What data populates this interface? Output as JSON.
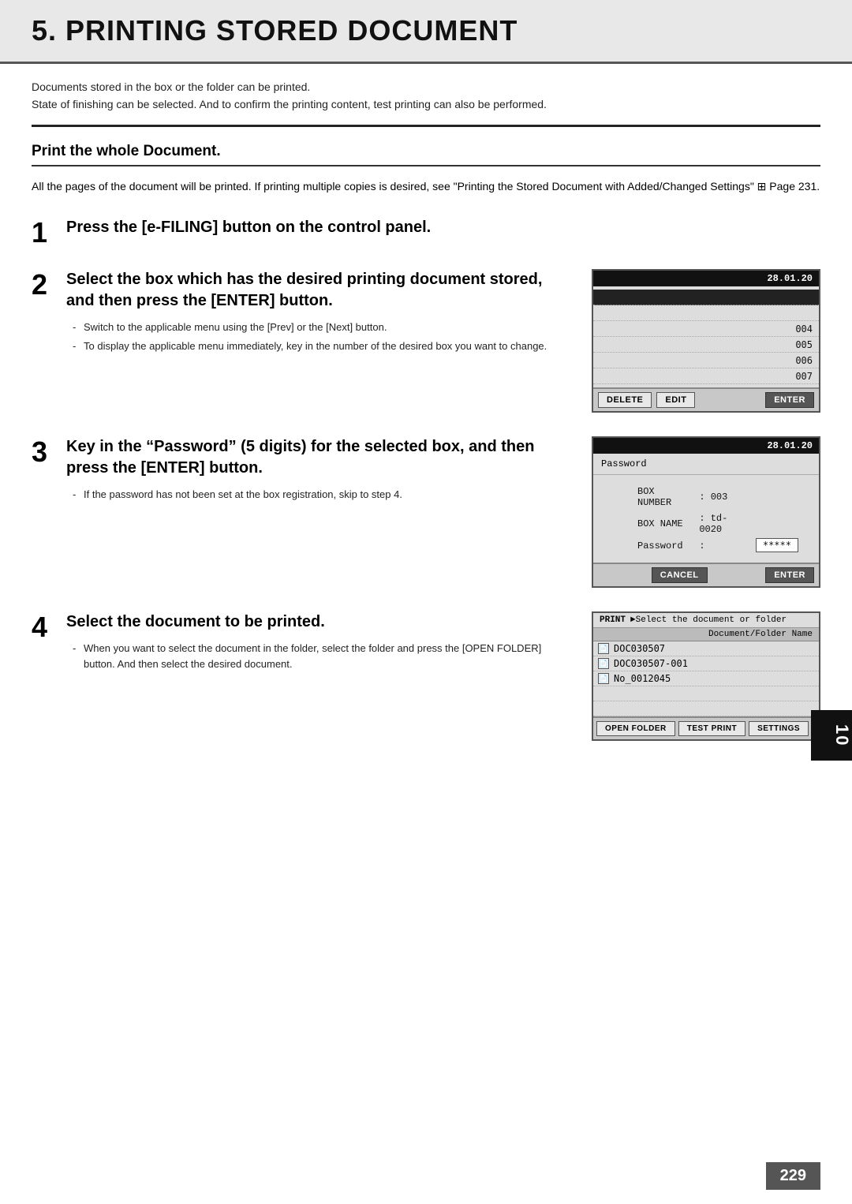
{
  "page": {
    "title": "5. PRINTING STORED DOCUMENT",
    "chapter_number": "10",
    "page_number": "229"
  },
  "intro": {
    "line1": "Documents stored in the box or the folder can be printed.",
    "line2": "State of finishing can be selected. And to confirm the printing content, test printing can also be performed."
  },
  "section1": {
    "heading": "Print the whole Document.",
    "body": "All the pages of the document will be printed. If printing multiple copies is desired, see \"Printing the Stored Document with Added/Changed Settings\" ⊞ Page 231."
  },
  "step1": {
    "number": "1",
    "title": "Press the [e-FILING] button on the control panel."
  },
  "step2": {
    "number": "2",
    "title": "Select the box which has the desired printing document stored, and then press the [ENTER] button.",
    "bullets": [
      "Switch to the applicable menu using the [Prev] or the [Next] button.",
      "To display the applicable menu immediately, key in the number of the desired box you want to change."
    ],
    "screen": {
      "topbar": "28.01.20",
      "rows": [
        {
          "label": "",
          "num": "",
          "selected": true
        },
        {
          "label": "",
          "num": "",
          "selected": false
        },
        {
          "label": "",
          "num": "004",
          "selected": false
        },
        {
          "label": "",
          "num": "005",
          "selected": false
        },
        {
          "label": "",
          "num": "006",
          "selected": false
        },
        {
          "label": "",
          "num": "007",
          "selected": false
        }
      ],
      "buttons": {
        "delete": "DELETE",
        "edit": "EDIT",
        "enter": "ENTER"
      }
    }
  },
  "step3": {
    "number": "3",
    "title": "Key in the “Password” (5 digits) for the selected box, and then press the [ENTER] button.",
    "bullets": [
      "If the password has not been set at the box registration, skip to step 4."
    ],
    "screen": {
      "topbar": "28.01.20",
      "password_label": "Password",
      "box_number_label": "BOX NUMBER",
      "box_number_value": ": 003",
      "box_name_label": "BOX NAME",
      "box_name_value": ": td-0020",
      "field_label": "Password",
      "field_colon": ":",
      "field_value": "*****",
      "cancel_btn": "CANCEL",
      "enter_btn": "ENTER"
    }
  },
  "step4": {
    "number": "4",
    "title": "Select the document to be printed.",
    "bullets": [
      "When you want to select the document in the folder, select the folder and press the [OPEN FOLDER] button. And then select the desired document."
    ],
    "screen": {
      "header_prefix": "PRINT",
      "header_text": "►Select the document or folder",
      "column_header": "Document/Folder Name",
      "docs": [
        {
          "name": "DOC030507"
        },
        {
          "name": "DOC030507-001"
        },
        {
          "name": "No_0012045"
        }
      ],
      "btn_open": "OPEN FOLDER",
      "btn_test": "TEST PRINT",
      "btn_settings": "SETTINGS"
    }
  }
}
